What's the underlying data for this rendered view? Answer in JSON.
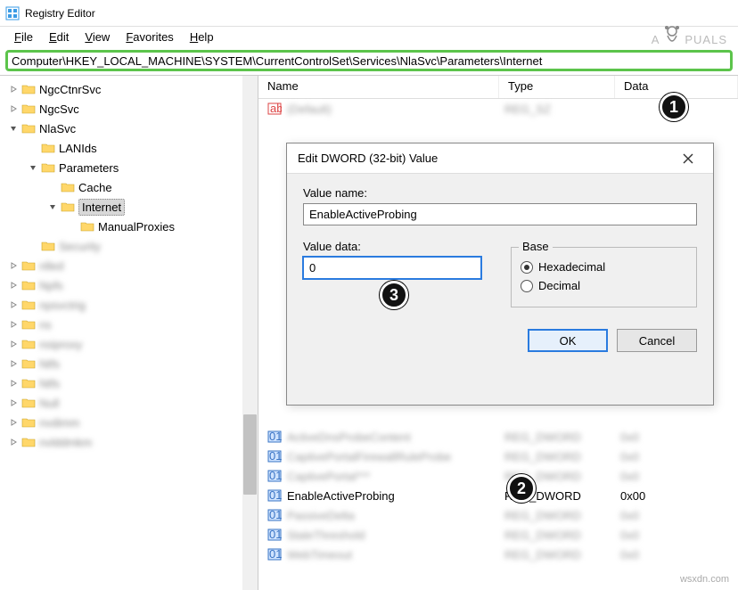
{
  "window_title": "Registry Editor",
  "menubar": {
    "file": "File",
    "edit": "Edit",
    "view": "View",
    "favorites": "Favorites",
    "help": "Help"
  },
  "address": "Computer\\HKEY_LOCAL_MACHINE\\SYSTEM\\CurrentControlSet\\Services\\NlaSvc\\Parameters\\Internet",
  "tree": {
    "items": [
      {
        "indent": 0,
        "exp": "closed",
        "label": "NgcCtnrSvc",
        "blur": false
      },
      {
        "indent": 0,
        "exp": "closed",
        "label": "NgcSvc",
        "blur": false
      },
      {
        "indent": 0,
        "exp": "open",
        "label": "NlaSvc",
        "blur": false
      },
      {
        "indent": 1,
        "exp": "none",
        "label": "LANIds",
        "blur": false
      },
      {
        "indent": 1,
        "exp": "open",
        "label": "Parameters",
        "blur": false
      },
      {
        "indent": 2,
        "exp": "none",
        "label": "Cache",
        "blur": false
      },
      {
        "indent": 2,
        "exp": "open",
        "label": "Internet",
        "blur": false,
        "selected": true
      },
      {
        "indent": 3,
        "exp": "none",
        "label": "ManualProxies",
        "blur": false
      },
      {
        "indent": 1,
        "exp": "none",
        "label": "Security",
        "blur": true
      },
      {
        "indent": 0,
        "exp": "closed",
        "label": "nlled",
        "blur": true
      },
      {
        "indent": 0,
        "exp": "closed",
        "label": "Npfs",
        "blur": true
      },
      {
        "indent": 0,
        "exp": "closed",
        "label": "npsvctrig",
        "blur": true
      },
      {
        "indent": 0,
        "exp": "closed",
        "label": "ns",
        "blur": true
      },
      {
        "indent": 0,
        "exp": "closed",
        "label": "nsiproxy",
        "blur": true
      },
      {
        "indent": 0,
        "exp": "closed",
        "label": "Ntfs",
        "blur": true
      },
      {
        "indent": 0,
        "exp": "closed",
        "label": "Ntfs",
        "blur": true
      },
      {
        "indent": 0,
        "exp": "closed",
        "label": "Null",
        "blur": true
      },
      {
        "indent": 0,
        "exp": "closed",
        "label": "nvdimm",
        "blur": true
      },
      {
        "indent": 0,
        "exp": "closed",
        "label": "nvlddmkm",
        "blur": true
      }
    ]
  },
  "list": {
    "headers": {
      "name": "Name",
      "type": "Type",
      "data": "Data"
    },
    "rows": [
      {
        "icon": "string",
        "name": "(Default)",
        "type": "REG_SZ",
        "data": "",
        "blur": true
      },
      {
        "icon": "dword",
        "name": "ActiveDnsProbeContent",
        "type": "REG_DWORD",
        "data": "0x0",
        "blur": true
      },
      {
        "icon": "dword",
        "name": "CaptivePortalFirewallRuleProbe",
        "type": "REG_DWORD",
        "data": "0x0",
        "blur": true
      },
      {
        "icon": "dword",
        "name": "CaptivePortal***",
        "type": "REG_DWORD",
        "data": "0x0",
        "blur": true
      },
      {
        "icon": "dword",
        "name": "EnableActiveProbing",
        "type": "REG_DWORD",
        "data": "0x00",
        "blur": false
      },
      {
        "icon": "dword",
        "name": "PassiveDelta",
        "type": "REG_DWORD",
        "data": "0x0",
        "blur": true
      },
      {
        "icon": "dword",
        "name": "StaleThreshold",
        "type": "REG_DWORD",
        "data": "0x0",
        "blur": true
      },
      {
        "icon": "dword",
        "name": "WebTimeout",
        "type": "REG_DWORD",
        "data": "0x0",
        "blur": true
      }
    ]
  },
  "dialog": {
    "title": "Edit DWORD (32-bit) Value",
    "value_name_label": "Value name:",
    "value_name": "EnableActiveProbing",
    "value_data_label": "Value data:",
    "value_data": "0",
    "base_label": "Base",
    "radio_hex": "Hexadecimal",
    "radio_dec": "Decimal",
    "ok": "OK",
    "cancel": "Cancel"
  },
  "callouts": {
    "c1": "1",
    "c2": "2",
    "c3": "3"
  },
  "watermark": {
    "left": "A",
    "right": "PUALS"
  },
  "attribution": "wsxdn.com"
}
